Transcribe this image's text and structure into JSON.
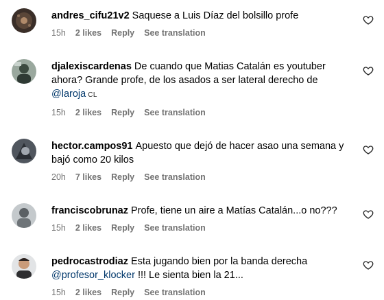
{
  "comments": [
    {
      "username": "andres_cifu21v2",
      "text": "Saquese a Luis Díaz del bolsillo profe",
      "time": "15h",
      "likes": "2 likes",
      "reply": "Reply",
      "translate": "See translation"
    },
    {
      "username": "djalexiscardenas",
      "text": "De cuando que Matias Catalán es youtuber ahora? Grande profe, de los asados a ser lateral derecho de",
      "mention": "@laroja",
      "flag": "CL",
      "time": "15h",
      "likes": "2 likes",
      "reply": "Reply",
      "translate": "See translation"
    },
    {
      "username": "hector.campos91",
      "text": "Apuesto que dejó de hacer asao una semana y bajó como 20 kilos",
      "time": "20h",
      "likes": "7 likes",
      "reply": "Reply",
      "translate": "See translation"
    },
    {
      "username": "franciscobrunaz",
      "text": "Profe, tiene un aire a Matías Catalán...o no???",
      "time": "15h",
      "likes": "2 likes",
      "reply": "Reply",
      "translate": "See translation"
    },
    {
      "username": "pedrocastrodiaz",
      "text": "Esta jugando bien por la banda derecha",
      "mention": "@profesor_klocker",
      "text_after": "!!! Le sienta bien la 21...",
      "time": "15h",
      "likes": "2 likes",
      "reply": "Reply",
      "translate": "See translation"
    }
  ],
  "icons": {
    "like": "heart-outline-icon"
  },
  "colors": {
    "meta": "#737373",
    "mention": "#00376b",
    "text": "#000000"
  }
}
